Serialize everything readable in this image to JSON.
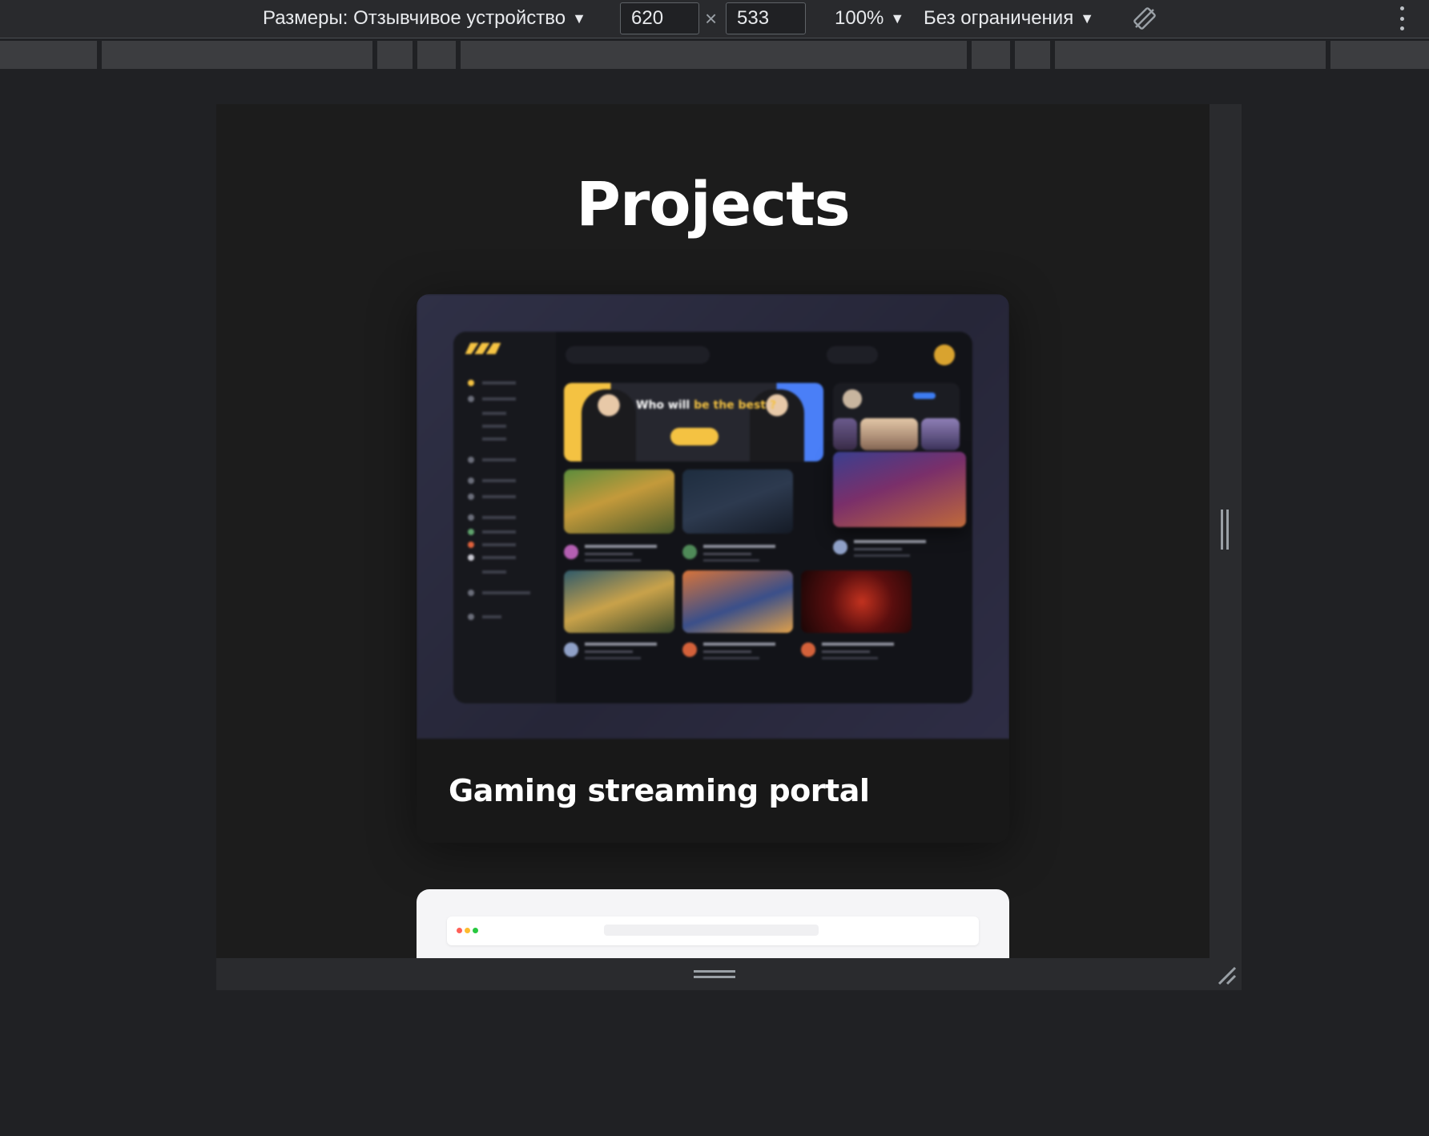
{
  "toolbar": {
    "device_label": "Размеры: Отзывчивое устройство",
    "width_value": "620",
    "height_value": "533",
    "times_symbol": "×",
    "zoom_label": "100%",
    "throttle_label": "Без ограничения",
    "dropdown_caret": "▼",
    "rotate_icon": "rotate-icon",
    "more_icon": "kebab-menu-icon"
  },
  "page": {
    "title": "Projects",
    "projects": [
      {
        "title": "Gaming streaming portal"
      },
      {
        "title": ""
      }
    ],
    "mockup": {
      "banner_text_1": "Who will ",
      "banner_text_2": "be the best ?"
    }
  },
  "colors": {
    "page_background": "#1c1c1c",
    "toolbar_background": "#292a2d",
    "accent_yellow": "#f4c242",
    "accent_blue": "#4a7ff7"
  }
}
